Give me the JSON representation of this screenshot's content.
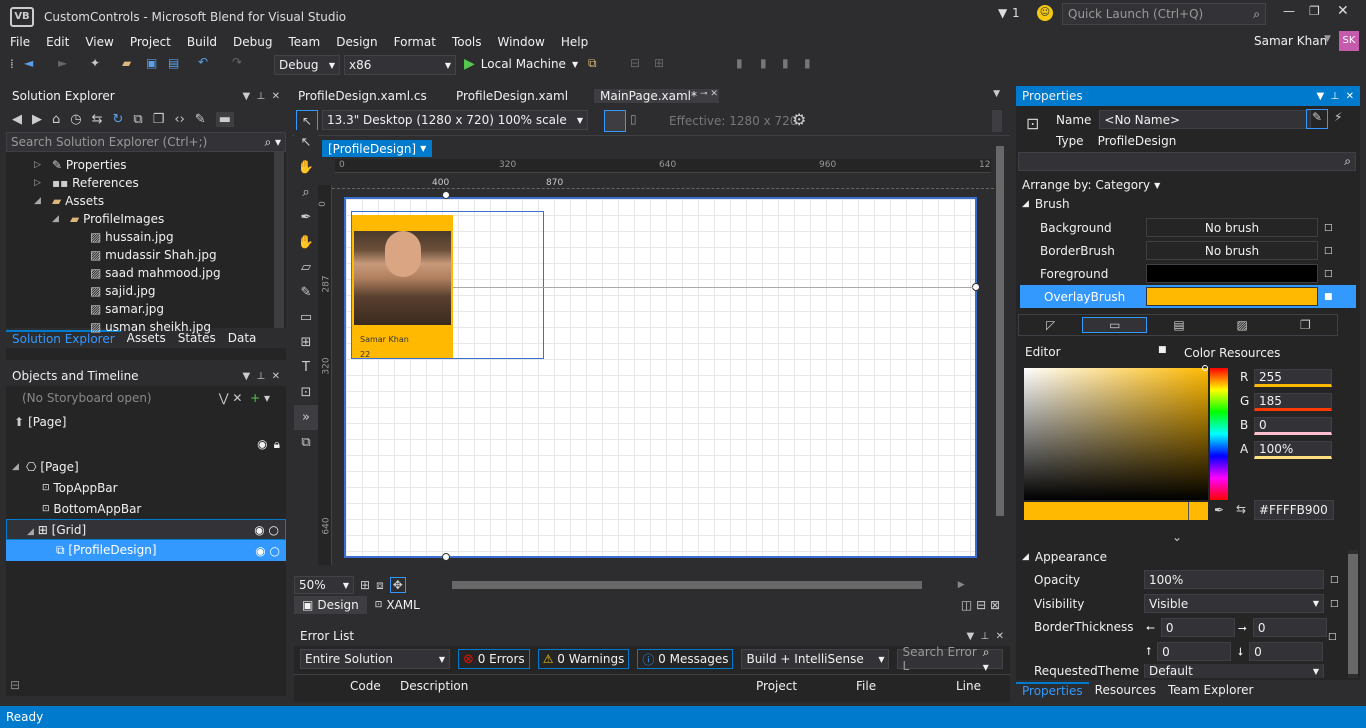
{
  "window": {
    "title": "CustomControls - Microsoft Blend for Visual Studio",
    "notification_count": "1",
    "quick_launch_placeholder": "Quick Launch (Ctrl+Q)",
    "user_name": "Samar Khan",
    "user_initials": "SK"
  },
  "menu": [
    "File",
    "Edit",
    "View",
    "Project",
    "Build",
    "Debug",
    "Team",
    "Design",
    "Format",
    "Tools",
    "Window",
    "Help"
  ],
  "toolbar": {
    "configuration": "Debug",
    "platform": "x86",
    "run_target": "Local Machine"
  },
  "solution_explorer": {
    "title": "Solution Explorer",
    "search_placeholder": "Search Solution Explorer (Ctrl+;)",
    "items": [
      "Properties",
      "References",
      "Assets",
      "ProfileImages",
      "hussain.jpg",
      "mudassir Shah.jpg",
      "saad mahmood.jpg",
      "sajid.jpg",
      "samar.jpg",
      "usman sheikh.jpg"
    ],
    "tabs": [
      "Solution Explorer",
      "Assets",
      "States",
      "Data"
    ]
  },
  "objects_timeline": {
    "title": "Objects and Timeline",
    "storyboard": "(No Storyboard open)",
    "scope": "[Page]",
    "items": [
      "[Page]",
      "TopAppBar",
      "BottomAppBar",
      "[Grid]",
      "[ProfileDesign]"
    ]
  },
  "editor": {
    "tabs": [
      "ProfileDesign.xaml.cs",
      "ProfileDesign.xaml",
      "MainPage.xaml*"
    ],
    "device": "13.3\" Desktop (1280 x 720) 100% scale",
    "effective": "Effective: 1280 x 720",
    "breadcrumb": "[ProfileDesign]",
    "ruler_top": [
      "0",
      "320",
      "640",
      "960",
      "12"
    ],
    "ruler_marks": [
      "400",
      "870"
    ],
    "ruler_left": [
      "0",
      "287",
      "320",
      "402",
      "640"
    ],
    "zoom": "50%",
    "view_tabs": [
      "Design",
      "XAML"
    ]
  },
  "profile_card": {
    "name": "Samar Khan",
    "age": "22",
    "color": "#FFB900"
  },
  "error_list": {
    "title": "Error List",
    "scope": "Entire Solution",
    "errors": "0 Errors",
    "warnings": "0 Warnings",
    "messages": "0 Messages",
    "build": "Build + IntelliSense",
    "search_placeholder": "Search Error L",
    "columns": [
      "Code",
      "Description",
      "Project",
      "File",
      "Line"
    ]
  },
  "properties": {
    "title": "Properties",
    "name_label": "Name",
    "name_value": "<No Name>",
    "type_label": "Type",
    "type_value": "ProfileDesign",
    "arrange": "Arrange by: Category",
    "brush_section": "Brush",
    "brushes": [
      {
        "label": "Background",
        "value": "No brush"
      },
      {
        "label": "BorderBrush",
        "value": "No brush"
      },
      {
        "label": "Foreground",
        "value": ""
      },
      {
        "label": "OverlayBrush",
        "value": ""
      }
    ],
    "editor_label": "Editor",
    "color_resources": "Color Resources",
    "r_label": "R",
    "r": "255",
    "g_label": "G",
    "g": "185",
    "b_label": "B",
    "b": "0",
    "a_label": "A",
    "a": "100%",
    "hex": "#FFFFB900",
    "appearance_section": "Appearance",
    "opacity_label": "Opacity",
    "opacity": "100%",
    "visibility_label": "Visibility",
    "visibility": "Visible",
    "border_label": "BorderThickness",
    "borders": [
      "0",
      "0",
      "0",
      "0"
    ],
    "requested_theme_label": "RequestedTheme",
    "requested_theme": "Default",
    "tabs": [
      "Properties",
      "Resources",
      "Team Explorer"
    ]
  },
  "status": "Ready",
  "colors": {
    "accent": "#007acc",
    "overlay": "#FFB900",
    "selection": "#3399ff"
  }
}
